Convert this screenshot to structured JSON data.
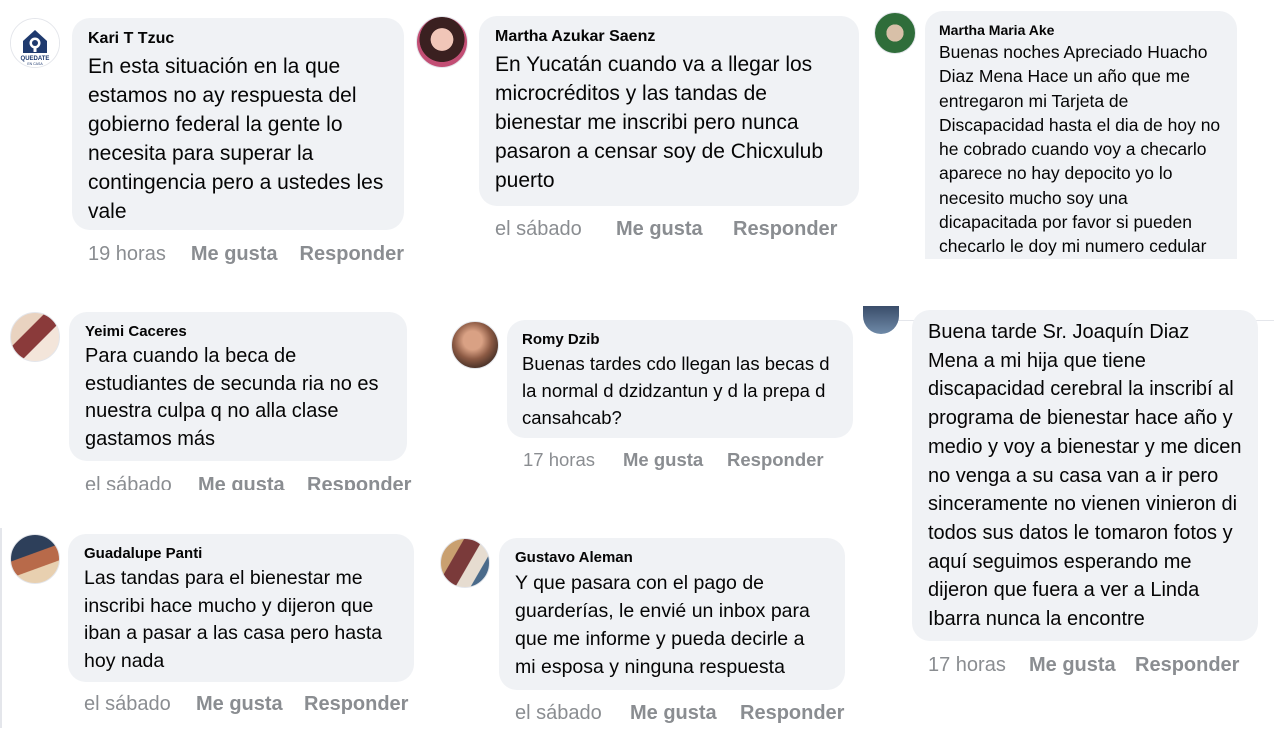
{
  "comments": [
    {
      "author": "Kari T Tzuc",
      "text": "En esta situación en la que estamos no ay respuesta del gobierno federal la gente lo necesita para superar la contingencia pero a ustedes les vale",
      "time": "19 horas",
      "like": "Me gusta",
      "reply": "Responder"
    },
    {
      "author": "Martha Azukar Saenz",
      "text": "En Yucatán cuando va a llegar los microcréditos y las tandas de bienestar me inscribi pero nunca pasaron a censar soy de Chicxulub puerto",
      "time": "el sábado",
      "like": "Me gusta",
      "reply": "Responder"
    },
    {
      "author": "Martha Maria Ake",
      "text": "Buenas noches Apreciado Huacho Diaz Mena Hace un año que me entregaron mi Tarjeta de Discapacidad hasta el dia de hoy no he cobrado cuando voy a checarlo aparece no hay depocito yo lo necesito mucho soy una dicapacitada por favor si pueden checarlo le doy mi numero cedular"
    },
    {
      "author": "Yeimi Caceres",
      "text": "Para cuando la beca de estudiantes de secunda ria no es nuestra culpa q no alla clase gastamos más",
      "time": "el sábado",
      "like": "Me gusta",
      "reply": "Responder"
    },
    {
      "author": "Romy Dzib",
      "text": "Buenas tardes cdo llegan las becas d la normal d dzidzantun y d la prepa d cansahcab?",
      "time": "17 horas",
      "like": "Me gusta",
      "reply": "Responder"
    },
    {
      "text": "Buena tarde Sr. Joaquín Diaz Mena a mi hija que tiene discapacidad cerebral la inscribí al programa de bienestar hace año y medio y voy a bienestar y me dicen no venga a su casa van a ir pero sinceramente no vienen vinieron di todos sus datos le tomaron fotos y aquí seguimos esperando me dijeron que fuera a ver a Linda Ibarra nunca la encontre",
      "time": "17 horas",
      "like": "Me gusta",
      "reply": "Responder"
    },
    {
      "author": "Guadalupe Panti",
      "text": "Las tandas para el bienestar me inscribi hace mucho y dijeron que iban a pasar a las casa pero hasta hoy nada",
      "time": "el sábado",
      "like": "Me gusta",
      "reply": "Responder"
    },
    {
      "author": "Gustavo Aleman",
      "text": "Y que pasara con el pago de guarderías, le envié un inbox para que me informe y pueda decirle a mi esposa y ninguna respuesta",
      "time": "el sábado",
      "like": "Me gusta",
      "reply": "Responder"
    }
  ],
  "logo": {
    "text": "QUEDATE",
    "sub": "EN CASA"
  }
}
